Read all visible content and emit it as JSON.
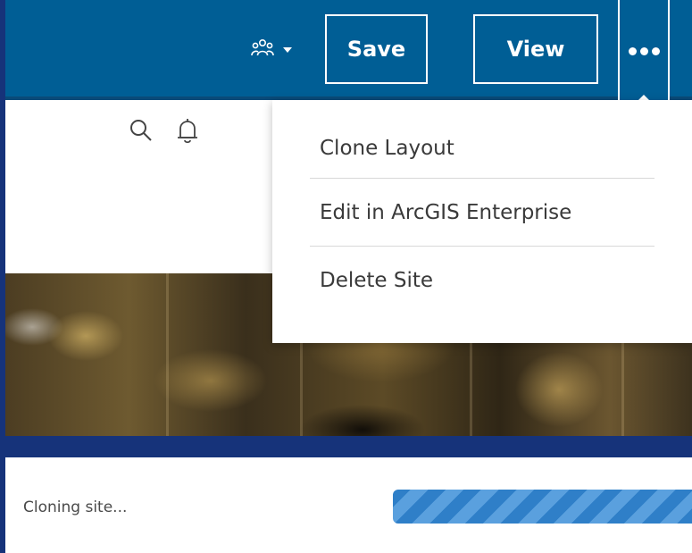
{
  "background_heading": "",
  "header": {
    "share_icon": "group-icon",
    "save_label": "Save",
    "view_label": "View",
    "more_icon": "ellipsis-icon"
  },
  "page": {
    "search_icon": "search-icon",
    "notification_icon": "bell-icon"
  },
  "menu": {
    "items": [
      {
        "label": "Clone Layout"
      },
      {
        "label": "Edit in ArcGIS Enterprise"
      },
      {
        "label": "Delete Site"
      }
    ]
  },
  "progress": {
    "label": "Cloning site...",
    "percent": 100,
    "style": "striped-indeterminate"
  },
  "colors": {
    "header_blue": "#005e95",
    "frame_navy": "#16337a",
    "progress_blue": "#2f7fc8"
  }
}
